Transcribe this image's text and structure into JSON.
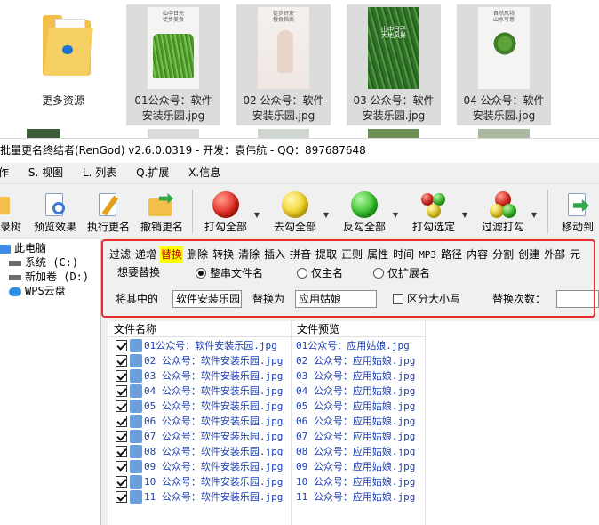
{
  "explorer": {
    "tiles": [
      {
        "label": "更多资源",
        "label2": ""
      },
      {
        "label": "01公众号：软件",
        "label2": "安装乐园.jpg",
        "thumb_text": "山中日光\n徒步美食"
      },
      {
        "label": "02 公众号：软件",
        "label2": "安装乐园.jpg",
        "thumb_text": "徒步好友\n慢食指南"
      },
      {
        "label": "03 公众号：软件",
        "label2": "安装乐园.jpg",
        "thumb_text": "山中日子\n大地风景"
      },
      {
        "label": "04 公众号：软件",
        "label2": "安装乐园.jpg",
        "thumb_text": "自然风物\n山水写意"
      }
    ]
  },
  "app": {
    "title": "批量更名终结者(RenGod) v2.6.0.0319 - 开发：袁伟航 - QQ：897687648",
    "menu": [
      "作",
      "S. 视图",
      "L. 列表",
      "Q.扩展",
      "X.信息"
    ],
    "toolbar": {
      "buttons": [
        {
          "label": "录树",
          "icon": "folder-tree-icon"
        },
        {
          "label": "预览效果",
          "icon": "preview-icon"
        },
        {
          "label": "执行更名",
          "icon": "rename-icon"
        },
        {
          "label": "撤销更名",
          "icon": "undo-rename-icon"
        },
        {
          "label": "打勾全部",
          "icon": "red-ball-icon"
        },
        {
          "label": "去勾全部",
          "icon": "yellow-ball-icon"
        },
        {
          "label": "反勾全部",
          "icon": "green-ball-icon"
        },
        {
          "label": "打勾选定",
          "icon": "multi-ball-icon"
        },
        {
          "label": "过滤打勾",
          "icon": "filter-ball-icon"
        },
        {
          "label": "移动到",
          "icon": "move-to-icon"
        }
      ]
    },
    "tree": {
      "items": [
        {
          "label": "此电脑",
          "icon": "computer-icon"
        },
        {
          "label": "系统 (C:)",
          "icon": "drive-icon"
        },
        {
          "label": "新加卷 (D:)",
          "icon": "drive-icon"
        },
        {
          "label": "WPS云盘",
          "icon": "cloud-icon"
        }
      ]
    },
    "options": {
      "tabs": [
        "过滤",
        "递增",
        "替换",
        "删除",
        "转换",
        "清除",
        "插入",
        "拼音",
        "提取",
        "正则",
        "属性",
        "时间",
        "MP3",
        "路径",
        "内容",
        "分割",
        "创建",
        "外部",
        "元"
      ],
      "active_tab": "替换",
      "group_title": "想要替换",
      "radios": [
        {
          "label": "整串文件名",
          "checked": true
        },
        {
          "label": "仅主名",
          "checked": false
        },
        {
          "label": "仅扩展名",
          "checked": false
        }
      ],
      "find_label": "将其中的",
      "find_value": "软件安装乐园",
      "replace_label": "替换为",
      "replace_value": "应用姑娘",
      "case_label": "区分大小写",
      "count_label": "替换次数：",
      "count_value": ""
    },
    "filelist": {
      "col_name": "文件名称",
      "col_preview": "文件预览",
      "rows": [
        {
          "name": "01公众号：软件安装乐园.jpg",
          "preview": "01公众号：应用姑娘.jpg"
        },
        {
          "name": "02 公众号：软件安装乐园.jpg",
          "preview": "02 公众号：应用姑娘.jpg"
        },
        {
          "name": "03 公众号：软件安装乐园.jpg",
          "preview": "03 公众号：应用姑娘.jpg"
        },
        {
          "name": "04 公众号：软件安装乐园.jpg",
          "preview": "04 公众号：应用姑娘.jpg"
        },
        {
          "name": "05 公众号：软件安装乐园.jpg",
          "preview": "05 公众号：应用姑娘.jpg"
        },
        {
          "name": "06 公众号：软件安装乐园.jpg",
          "preview": "06 公众号：应用姑娘.jpg"
        },
        {
          "name": "07 公众号：软件安装乐园.jpg",
          "preview": "07 公众号：应用姑娘.jpg"
        },
        {
          "name": "08 公众号：软件安装乐园.jpg",
          "preview": "08 公众号：应用姑娘.jpg"
        },
        {
          "name": "09 公众号：软件安装乐园.jpg",
          "preview": "09 公众号：应用姑娘.jpg"
        },
        {
          "name": "10 公众号：软件安装乐园.jpg",
          "preview": "10 公众号：应用姑娘.jpg"
        },
        {
          "name": "11 公众号：软件安装乐园.jpg",
          "preview": "11 公众号：应用姑娘.jpg"
        }
      ]
    },
    "colors": {
      "highlight": "#e82b2b",
      "active_tab_bg": "#ffff00",
      "filename_blue": "#1b3fb0"
    }
  }
}
